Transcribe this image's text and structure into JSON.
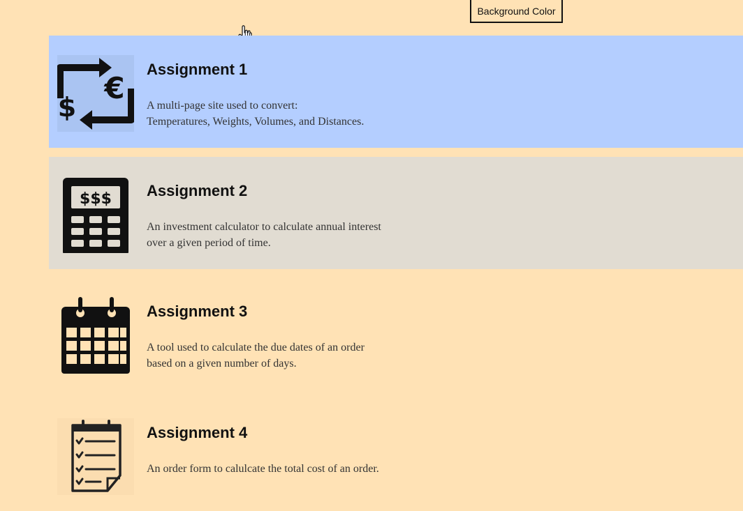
{
  "toolbar": {
    "bg_button_label": "Background Color"
  },
  "colors": {
    "page_bg": "#FFE2B5",
    "card1_bg": "#B4CEFF",
    "card2_bg": "#E1DCD2"
  },
  "assignments": [
    {
      "title": "Assignment 1",
      "desc_line1": "A multi-page site used to convert:",
      "desc_line2": "Temperatures, Weights, Volumes, and Distances.",
      "icon": "currency-exchange-icon"
    },
    {
      "title": "Assignment 2",
      "desc_line1": "An investment calculator to calculate annual interest",
      "desc_line2": "over a given period of time.",
      "icon": "calculator-icon"
    },
    {
      "title": "Assignment 3",
      "desc_line1": "A tool used to calculate the due dates of an order",
      "desc_line2": "based on a given number of days.",
      "icon": "calendar-icon"
    },
    {
      "title": "Assignment 4",
      "desc_line1": "An order form to calulcate the total cost of an order.",
      "desc_line2": "",
      "icon": "checklist-icon"
    }
  ]
}
